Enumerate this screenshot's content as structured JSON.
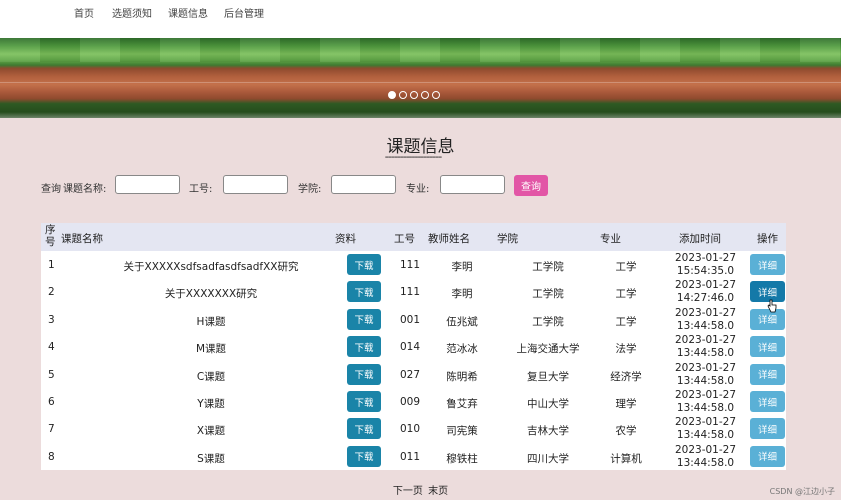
{
  "nav": {
    "items": [
      "首页",
      "选题须知",
      "课题信息",
      "后台管理"
    ]
  },
  "carousel": {
    "slides": 5,
    "active": 0
  },
  "page": {
    "title": "课题信息",
    "underline": "-------------------"
  },
  "search": {
    "prefix": "查询",
    "name_label": "课题名称:",
    "id_label": "工号:",
    "college_label": "学院:",
    "major_label": "专业:",
    "button": "查询"
  },
  "table": {
    "headers": {
      "seq": "序号",
      "name": "课题名称",
      "file": "资料",
      "id": "工号",
      "teacher": "教师姓名",
      "college": "学院",
      "major": "专业",
      "time": "添加时间",
      "action": "操作"
    },
    "download_label": "下载",
    "detail_label": "详细",
    "rows": [
      {
        "seq": "1",
        "name": "关于XXXXXsdfsadfasdfsadfXX研究",
        "id": "111",
        "teacher": "李明",
        "college": "工学院",
        "major": "工学",
        "date": "2023-01-27",
        "time": "15:54:35.0"
      },
      {
        "seq": "2",
        "name": "关于XXXXXXX研究",
        "id": "111",
        "teacher": "李明",
        "college": "工学院",
        "major": "工学",
        "date": "2023-01-27",
        "time": "14:27:46.0"
      },
      {
        "seq": "3",
        "name": "H课题",
        "id": "001",
        "teacher": "伍兆斌",
        "college": "工学院",
        "major": "工学",
        "date": "2023-01-27",
        "time": "13:44:58.0"
      },
      {
        "seq": "4",
        "name": "M课题",
        "id": "014",
        "teacher": "范冰冰",
        "college": "上海交通大学",
        "major": "法学",
        "date": "2023-01-27",
        "time": "13:44:58.0"
      },
      {
        "seq": "5",
        "name": "C课题",
        "id": "027",
        "teacher": "陈明希",
        "college": "复旦大学",
        "major": "经济学",
        "date": "2023-01-27",
        "time": "13:44:58.0"
      },
      {
        "seq": "6",
        "name": "Y课题",
        "id": "009",
        "teacher": "鲁艾弃",
        "college": "中山大学",
        "major": "理学",
        "date": "2023-01-27",
        "time": "13:44:58.0"
      },
      {
        "seq": "7",
        "name": "X课题",
        "id": "010",
        "teacher": "司宪策",
        "college": "吉林大学",
        "major": "农学",
        "date": "2023-01-27",
        "time": "13:44:58.0"
      },
      {
        "seq": "8",
        "name": "S课题",
        "id": "011",
        "teacher": "穆铁柱",
        "college": "四川大学",
        "major": "计算机",
        "date": "2023-01-27",
        "time": "13:44:58.0"
      }
    ]
  },
  "pager": {
    "next": "下一页",
    "last": "末页"
  },
  "watermark": "CSDN @江边小子",
  "colors": {
    "accent_pink": "#e256a6",
    "download_blue": "#1a84a8",
    "detail_blue": "#5ab0d6",
    "header_bg": "#e4e6f2",
    "page_bg": "#ecdcdc"
  }
}
